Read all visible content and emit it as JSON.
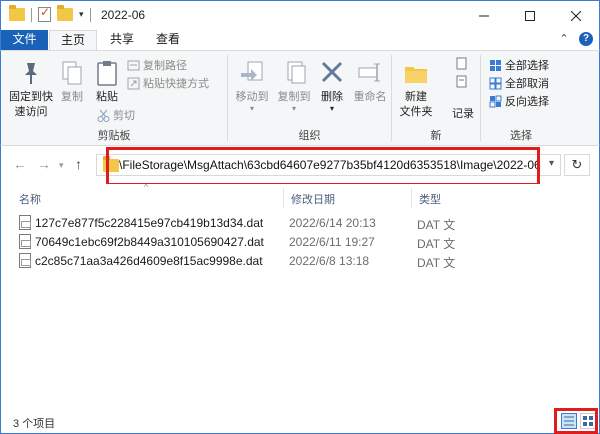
{
  "window": {
    "title": "2022-06"
  },
  "tabs": {
    "file": "文件",
    "home": "主页",
    "share": "共享",
    "view": "查看"
  },
  "ribbon": {
    "clipboard": {
      "label": "剪贴板",
      "pin_line1": "固定到快",
      "pin_line2": "速访问",
      "copy": "复制",
      "paste": "粘贴",
      "copy_path": "复制路径",
      "paste_shortcut": "粘贴快捷方式",
      "cut": "剪切"
    },
    "organize": {
      "label": "组织",
      "move_to": "移动到",
      "copy_to": "复制到",
      "delete": "删除",
      "rename": "重命名"
    },
    "new": {
      "label": "新",
      "new_folder_line1": "新建",
      "new_folder_line2": "文件夹",
      "record": "记录"
    },
    "select": {
      "label": "选择",
      "select_all": "全部选择",
      "select_none": "全部取消",
      "invert": "反向选择"
    }
  },
  "address": {
    "path": "\\FileStorage\\MsgAttach\\63cbd64607e9277b35bf4120d6353518\\Image\\2022-06"
  },
  "columns": {
    "name": "名称",
    "date": "修改日期",
    "type": "类型"
  },
  "files": [
    {
      "name": "127c7e877f5c228415e97cb419b13d34.dat",
      "date": "2022/6/14 20:13",
      "type": "DAT 文"
    },
    {
      "name": "70649c1ebc69f2b8449a310105690427.dat",
      "date": "2022/6/11 19:27",
      "type": "DAT 文"
    },
    {
      "name": "c2c85c71aa3a426d4609e8f15ac9998e.dat",
      "date": "2022/6/8 13:18",
      "type": "DAT 文"
    }
  ],
  "status": {
    "count": "3 个项目"
  },
  "colors": {
    "accent": "#1a62b8",
    "highlight": "#e01c1c",
    "folder": "#f3c646"
  }
}
